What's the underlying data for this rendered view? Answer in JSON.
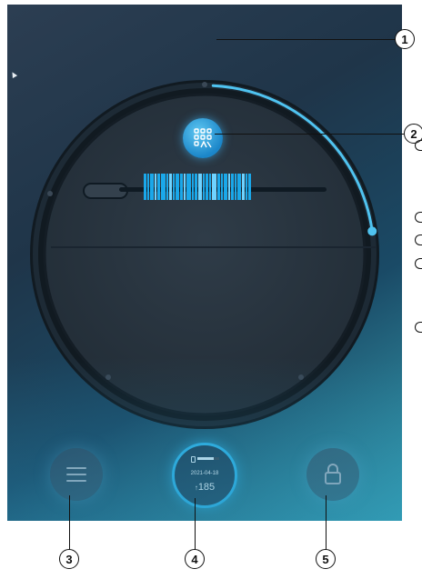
{
  "device": {
    "status": {
      "battery_level": 0.75,
      "date": "2021-04-18",
      "count": "185",
      "count_arrow": "↑"
    },
    "progress_fraction": 0.22
  },
  "buttons": {
    "scan_icon": "barcode-scan-icon",
    "menu_icon": "menu-icon",
    "lock_icon": "lock-icon"
  },
  "callouts": {
    "c1": "1",
    "c2": "2",
    "c3": "3",
    "c4": "4",
    "c5": "5"
  },
  "colors": {
    "accent": "#2fb2e6",
    "barcode": "#1aa8ea"
  }
}
